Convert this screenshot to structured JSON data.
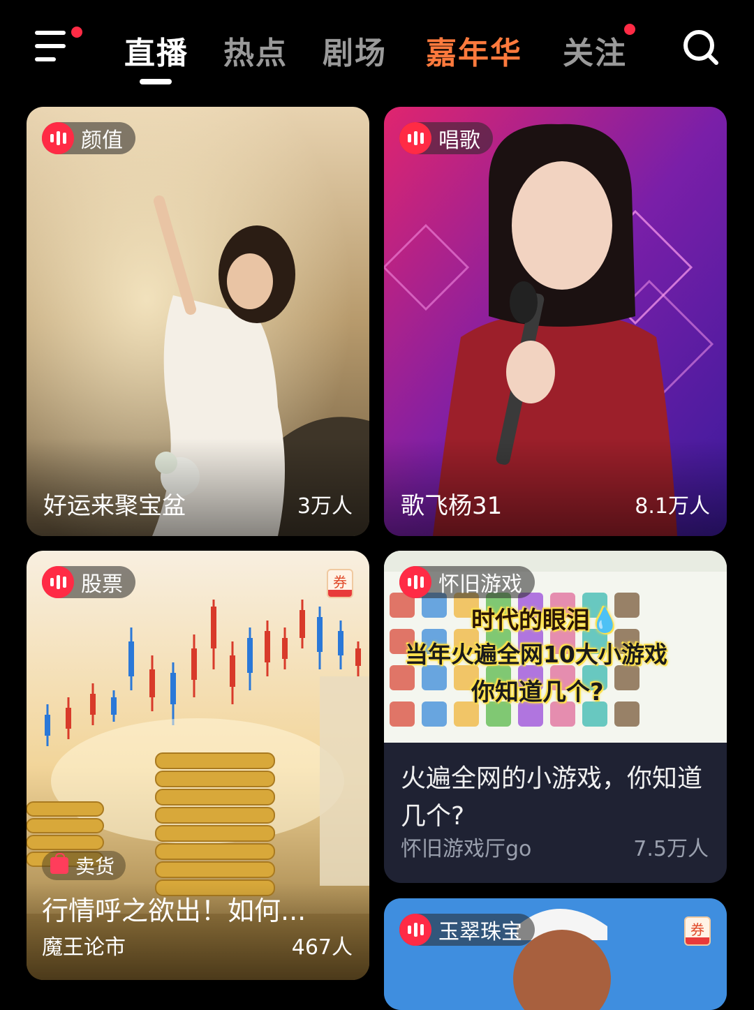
{
  "nav": {
    "tabs": [
      {
        "label": "直播",
        "active": true
      },
      {
        "label": "热点"
      },
      {
        "label": "剧场"
      },
      {
        "label": "嘉年华",
        "highlight_color": "#ff7a3d"
      },
      {
        "label": "关注",
        "has_dot": true
      }
    ],
    "menu_icon": "menu-icon",
    "search_icon": "search-icon",
    "accent_dot_color": "#ff2b45"
  },
  "cards": [
    {
      "tag": "颜值",
      "title": "好运来聚宝盆",
      "viewers": "3万人"
    },
    {
      "tag": "唱歌",
      "title": "歌飞杨31",
      "viewers": "8.1万人"
    },
    {
      "tag": "股票",
      "coupon": "券",
      "badge": "卖货",
      "title": "行情呼之欲出！如何...",
      "host": "魔王论市",
      "viewers": "467人"
    },
    {
      "tag": "怀旧游戏",
      "banner_lines": [
        "时代的眼泪💧",
        "当年火遍全网10大小游戏",
        "你知道几个?"
      ],
      "title": "火遍全网的小游戏，你知道几个?",
      "host": "怀旧游戏厅go",
      "viewers": "7.5万人"
    },
    {
      "tag": "玉翠珠宝",
      "coupon": "券"
    }
  ]
}
